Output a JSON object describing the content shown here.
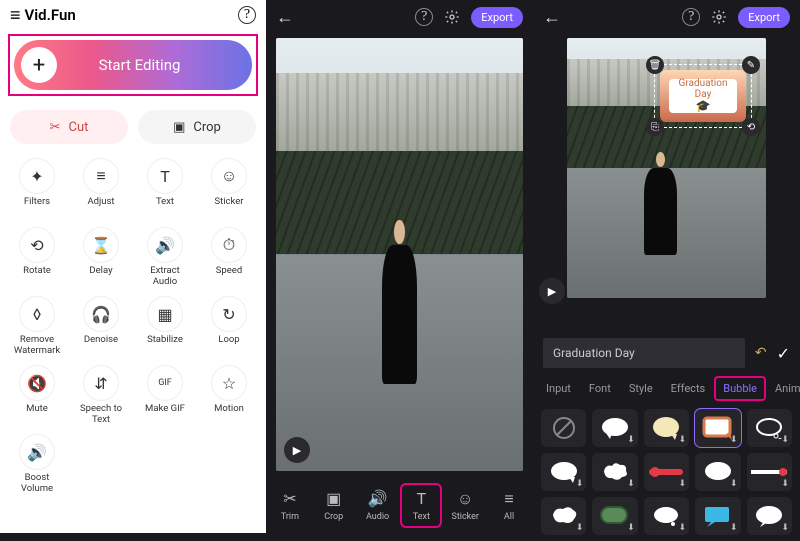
{
  "app": {
    "name": "Vid.Fun"
  },
  "left": {
    "start_label": "Start Editing",
    "actions": {
      "cut": "Cut",
      "crop": "Crop"
    },
    "tools": [
      {
        "id": "filters",
        "label": "Filters"
      },
      {
        "id": "adjust",
        "label": "Adjust"
      },
      {
        "id": "text",
        "label": "Text"
      },
      {
        "id": "sticker",
        "label": "Sticker"
      },
      {
        "id": "rotate",
        "label": "Rotate"
      },
      {
        "id": "delay",
        "label": "Delay"
      },
      {
        "id": "extract-audio",
        "label": "Extract\nAudio"
      },
      {
        "id": "speed",
        "label": "Speed"
      },
      {
        "id": "remove-watermark",
        "label": "Remove\nWatermark"
      },
      {
        "id": "denoise",
        "label": "Denoise"
      },
      {
        "id": "stabilize",
        "label": "Stabilize"
      },
      {
        "id": "loop",
        "label": "Loop"
      },
      {
        "id": "mute",
        "label": "Mute"
      },
      {
        "id": "speech-to-text",
        "label": "Speech to\nText"
      },
      {
        "id": "make-gif",
        "label": "Make GIF"
      },
      {
        "id": "motion",
        "label": "Motion"
      },
      {
        "id": "boost-volume",
        "label": "Boost\nVolume"
      }
    ]
  },
  "mid": {
    "export": "Export",
    "bottom": [
      {
        "id": "trim",
        "label": "Trim"
      },
      {
        "id": "crop",
        "label": "Crop"
      },
      {
        "id": "audio",
        "label": "Audio"
      },
      {
        "id": "text",
        "label": "Text"
      },
      {
        "id": "sticker",
        "label": "Sticker"
      },
      {
        "id": "all",
        "label": "All"
      }
    ],
    "active": "text"
  },
  "right": {
    "export": "Export",
    "overlay_text_1": "Graduation",
    "overlay_text_2": "Day",
    "input_value": "Graduation Day",
    "tabs": [
      "Input",
      "Font",
      "Style",
      "Effects",
      "Bubble",
      "Animation"
    ],
    "active_tab": "Bubble"
  }
}
